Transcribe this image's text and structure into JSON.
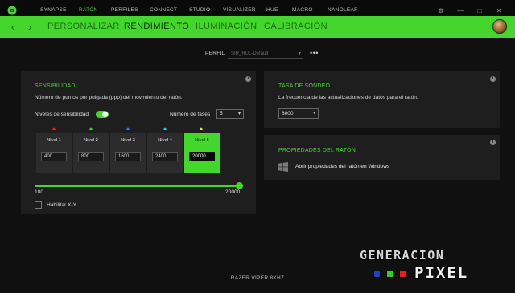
{
  "topnav": {
    "items": [
      {
        "label": "SYNAPSE",
        "active": false
      },
      {
        "label": "RATÓN",
        "active": true
      },
      {
        "label": "PERFILES",
        "active": false
      },
      {
        "label": "CONNECT",
        "active": false
      },
      {
        "label": "STUDIO",
        "active": false
      },
      {
        "label": "VISUALIZER",
        "active": false
      },
      {
        "label": "HUE",
        "active": false
      },
      {
        "label": "MACRO",
        "active": false
      },
      {
        "label": "NANOLEAF",
        "active": false
      }
    ]
  },
  "subnav": {
    "tabs": [
      {
        "label": "PERSONALIZAR",
        "active": false
      },
      {
        "label": "RENDIMIENTO",
        "active": true
      },
      {
        "label": "ILUMINACIÓN",
        "active": false
      },
      {
        "label": "CALIBRACIÓN",
        "active": false
      }
    ]
  },
  "profile": {
    "label": "PERFIL",
    "value": "SIR_RUL-Default",
    "more": "•••"
  },
  "sensitivity": {
    "title": "SENSIBILIDAD",
    "description": "Número de puntos por pulgada (ppp) del movimiento del ratón.",
    "toggle_label": "Niveles de sensibilidad",
    "stages_label": "Número de fases",
    "stages_value": "5",
    "levels": [
      {
        "name": "Nivel 1",
        "value": "400",
        "color": "#e8241a",
        "active": false
      },
      {
        "name": "Nivel 2",
        "value": "800",
        "color": "#44d62c",
        "active": false
      },
      {
        "name": "Nivel 3",
        "value": "1600",
        "color": "#2a7bff",
        "active": false
      },
      {
        "name": "Nivel 4",
        "value": "2400",
        "color": "#2fc4e6",
        "active": false
      },
      {
        "name": "Nivel 5",
        "value": "20000",
        "color": "#d9e82c",
        "active": true
      }
    ],
    "slider_min": "100",
    "slider_max": "20000",
    "xy_label": "Habilitar X-Y"
  },
  "polling": {
    "title": "TASA DE SONDEO",
    "description": "La frecuencia de las actualizaciones de datos para el ratón.",
    "value": "8000"
  },
  "mouse_props": {
    "title": "PROPIEDADES DEL RATÓN",
    "link": "Abrir propiedades del ratón en Windows"
  },
  "watermark": {
    "line1": "GENERACION",
    "line2": "PIXEL"
  },
  "device": "RAZER VIPER 8KHZ",
  "colors": {
    "accent": "#44d62c",
    "background": "#101010",
    "panel": "#1e1e1e"
  }
}
